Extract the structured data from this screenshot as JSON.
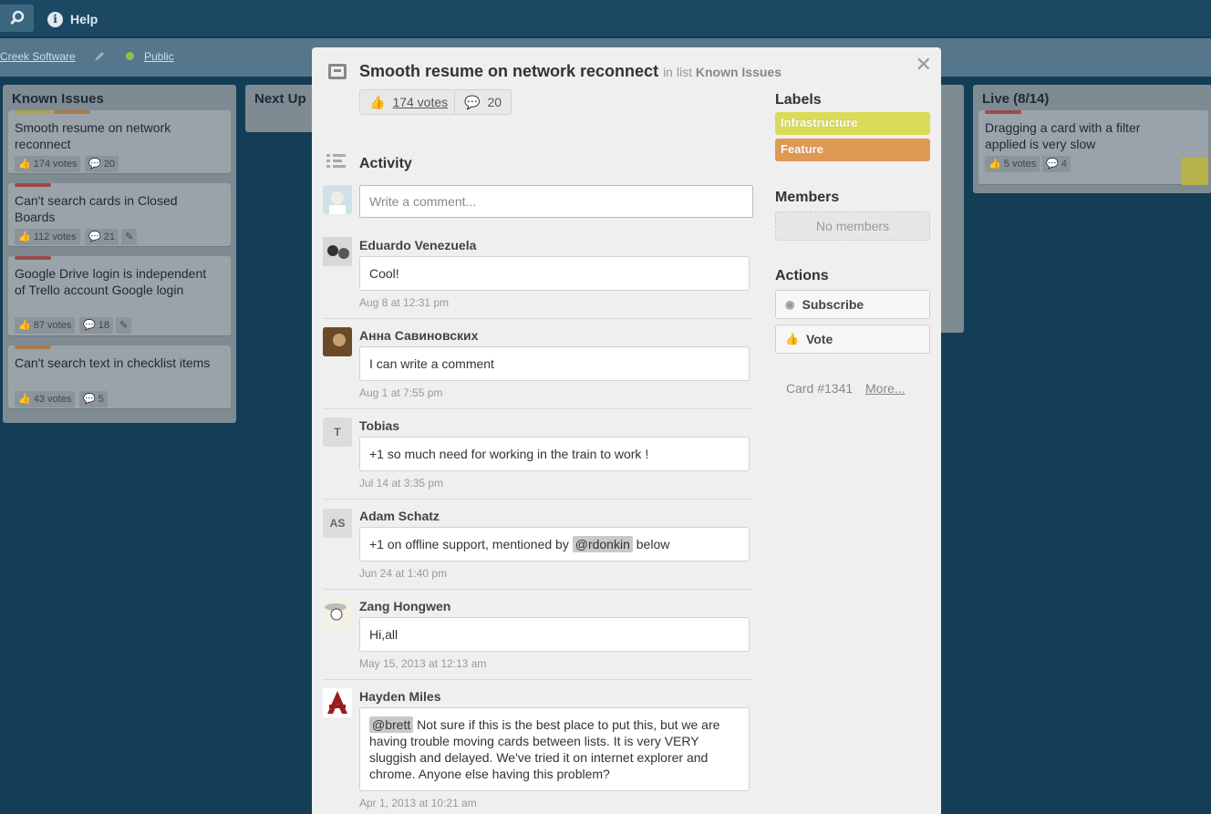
{
  "topbar": {
    "help_label": "Help"
  },
  "subheader": {
    "org": "Creek Software",
    "visibility": "Public"
  },
  "lists": [
    {
      "title": "Known Issues",
      "cards": [
        {
          "title": "Smooth resume on network reconnect",
          "votes": "174 votes",
          "comments": "20"
        },
        {
          "title": "Can't search cards in Closed Boards",
          "votes": "112 votes",
          "comments": "21"
        },
        {
          "title": "Google Drive login is independent of Trello account Google login",
          "votes": "87 votes",
          "comments": "18"
        },
        {
          "title": "Can't search text in checklist items",
          "votes": "43 votes",
          "comments": "5"
        }
      ]
    },
    {
      "title": "Next Up"
    },
    {
      "title": "Live (8/14)",
      "cards": [
        {
          "title": "Dragging a card with a filter applied is very slow",
          "votes": "5 votes",
          "comments": "4"
        }
      ]
    }
  ],
  "modal": {
    "title": "Smooth resume on network reconnect",
    "in_list_prefix": "in list",
    "list_name": "Known Issues",
    "votes": "174 votes",
    "comments_count": "20",
    "activity_heading": "Activity",
    "comment_placeholder": "Write a comment...",
    "comments": [
      {
        "author": "Eduardo Venezuela",
        "text": "Cool!",
        "time": "Aug 8 at 12:31 pm"
      },
      {
        "author": "Анна Савиновских",
        "text": "I can write a comment",
        "time": "Aug 1 at 7:55 pm"
      },
      {
        "author": "Tobias",
        "initials": "T",
        "text": "+1 so much need for working in the train to work !",
        "time": "Jul 14 at 3:35 pm"
      },
      {
        "author": "Adam Schatz",
        "initials": "AS",
        "text_before": "+1 on offline support, mentioned by ",
        "mention": "@rdonkin",
        "text_after": " below",
        "time": "Jun 24 at 1:40 pm"
      },
      {
        "author": "Zang Hongwen",
        "text": "Hi,all",
        "time": "May 15, 2013 at 12:13 am"
      },
      {
        "author": "Hayden Miles",
        "mention": "@brett",
        "text_after": " Not sure if this is the best place to put this, but we are having trouble moving cards between lists. It is very VERY sluggish and delayed. We've tried it on internet explorer and chrome. Anyone else having this problem?",
        "time": "Apr 1, 2013 at 10:21 am"
      }
    ],
    "sidebar": {
      "labels_heading": "Labels",
      "labels": [
        {
          "name": "Infrastructure",
          "color": "#dbdb57"
        },
        {
          "name": "Feature",
          "color": "#e09952"
        }
      ],
      "members_heading": "Members",
      "no_members": "No members",
      "actions_heading": "Actions",
      "subscribe_label": "Subscribe",
      "vote_label": "Vote",
      "card_number": "Card #1341",
      "more_link": "More..."
    }
  }
}
